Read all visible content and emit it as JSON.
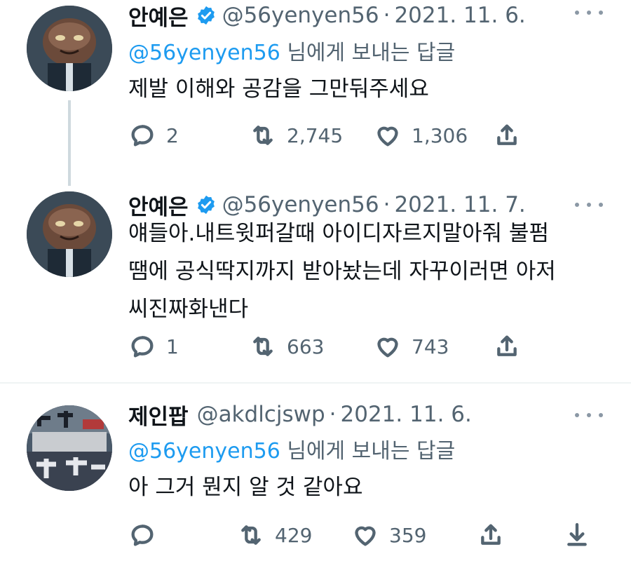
{
  "tweets": [
    {
      "name": "안예은",
      "verified": true,
      "handle": "@56yenyen56",
      "separator": "·",
      "date": "2021. 11. 6.",
      "reply_mention": "@56yenyen56",
      "reply_suffix": " 님에게 보내는 답글",
      "text": "제발 이해와 공감을 그만둬주세요",
      "replies": "2",
      "retweets": "2,745",
      "likes": "1,306"
    },
    {
      "name": "안예은",
      "verified": true,
      "handle": "@56yenyen56",
      "separator": "·",
      "date": "2021. 11. 7.",
      "text_lines": [
        "얘들아.내트윗퍼갈때 아이디자르지말아줘 불펌",
        "땜에 공식딱지까지 받아놨는데 자꾸이러면 아저",
        "씨진짜화낸다"
      ],
      "replies": "1",
      "retweets": "663",
      "likes": "743"
    },
    {
      "name": "제인팝",
      "verified": false,
      "handle": "@akdlcjswp",
      "separator": "·",
      "date": "2021. 11. 6.",
      "reply_mention": "@56yenyen56",
      "reply_suffix": " 님에게 보내는 답글",
      "text": "아 그거 뭔지 알 것 같아요",
      "replies": "",
      "retweets": "429",
      "likes": "359"
    }
  ],
  "colors": {
    "text": "#0f1419",
    "secondary": "#536471",
    "accent": "#1d9bf0",
    "divider": "#eff3f4"
  },
  "icons": {
    "reply": "reply-icon",
    "retweet": "retweet-icon",
    "like": "heart-icon",
    "share": "share-icon",
    "download": "download-icon",
    "verified": "verified-badge-icon",
    "more": "more-options-icon"
  }
}
